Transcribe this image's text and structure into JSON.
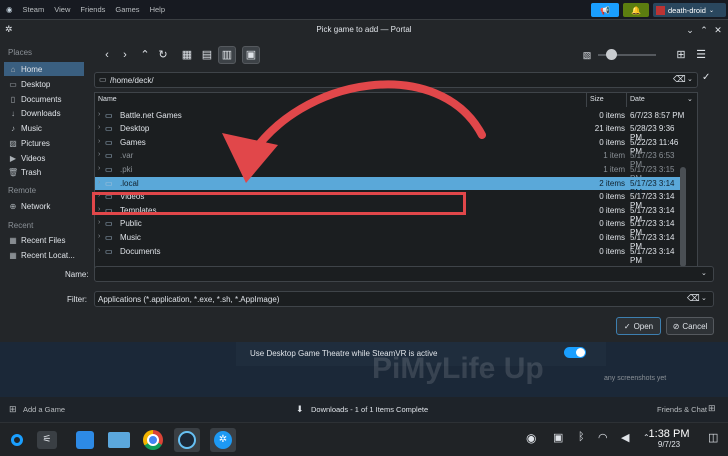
{
  "steam": {
    "logo": "steam-icon",
    "menu": [
      "Steam",
      "View",
      "Friends",
      "Games",
      "Help"
    ],
    "user": "death-droid"
  },
  "dialog": {
    "title": "Pick game to add — Portal",
    "path": "/home/deck/",
    "places_header": "Places",
    "remote_header": "Remote",
    "recent_header": "Recent",
    "places": [
      "Home",
      "Desktop",
      "Documents",
      "Downloads",
      "Music",
      "Pictures",
      "Videos",
      "Trash"
    ],
    "remote": [
      "Network"
    ],
    "recent": [
      "Recent Files",
      "Recent Locat..."
    ],
    "columns": {
      "name": "Name",
      "size": "Size",
      "date": "Date"
    },
    "files": [
      {
        "name": "Battle.net Games",
        "size": "0 items",
        "date": "6/7/23 8:57 PM"
      },
      {
        "name": "Desktop",
        "size": "21 items",
        "date": "5/28/23 9:36 PM"
      },
      {
        "name": "Games",
        "size": "0 items",
        "date": "5/22/23 11:46 PM"
      },
      {
        "name": ".var",
        "size": "1 item",
        "date": "5/17/23 6:53 PM"
      },
      {
        "name": ".pki",
        "size": "1 item",
        "date": "5/17/23 3:15 PM"
      },
      {
        "name": ".local",
        "size": "2 items",
        "date": "5/17/23 3:14 PM"
      },
      {
        "name": "Videos",
        "size": "0 items",
        "date": "5/17/23 3:14 PM"
      },
      {
        "name": "Templates",
        "size": "0 items",
        "date": "5/17/23 3:14 PM"
      },
      {
        "name": "Public",
        "size": "0 items",
        "date": "5/17/23 3:14 PM"
      },
      {
        "name": "Music",
        "size": "0 items",
        "date": "5/17/23 3:14 PM"
      },
      {
        "name": "Documents",
        "size": "0 items",
        "date": "5/17/23 3:14 PM"
      }
    ],
    "name_label": "Name:",
    "name_value": "",
    "filter_label": "Filter:",
    "filter_value": "Applications (*.application, *.exe, *.sh, *.AppImage)",
    "open_label": "Open",
    "cancel_label": "Cancel"
  },
  "steam_content": {
    "setting_text": "Use Desktop Game Theatre while SteamVR is active",
    "partial_text": "any screenshots yet",
    "watermark": "PiMyLife Up"
  },
  "steam_bottom": {
    "add_game": "Add a Game",
    "downloads": "Downloads - 1 of 1 Items Complete",
    "friends": "Friends & Chat"
  },
  "taskbar": {
    "time": "1:38 PM",
    "date": "9/7/23"
  },
  "colors": {
    "selection": "#5aa8d9",
    "annotation_red": "#e1474a",
    "accent_blue": "#1a9fff",
    "status_green": "#5c7e10"
  }
}
